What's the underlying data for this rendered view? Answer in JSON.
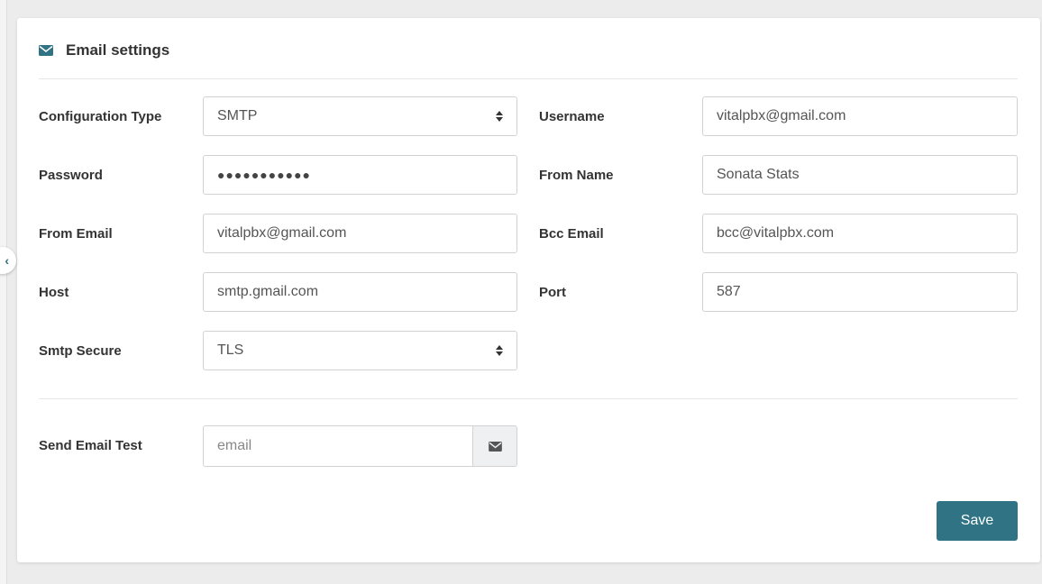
{
  "card": {
    "title": "Email settings",
    "icon": "envelope-icon"
  },
  "colors": {
    "accent": "#2f7384",
    "background": "#ececec"
  },
  "fields": {
    "configuration_type": {
      "label": "Configuration Type",
      "value": "SMTP"
    },
    "username": {
      "label": "Username",
      "value": "vitalpbx@gmail.com"
    },
    "password": {
      "label": "Password",
      "value": "●●●●●●●●●●●"
    },
    "from_name": {
      "label": "From Name",
      "value": "Sonata Stats"
    },
    "from_email": {
      "label": "From Email",
      "value": "vitalpbx@gmail.com"
    },
    "bcc_email": {
      "label": "Bcc Email",
      "value": "bcc@vitalpbx.com"
    },
    "host": {
      "label": "Host",
      "value": "smtp.gmail.com"
    },
    "port": {
      "label": "Port",
      "value": "587"
    },
    "smtp_secure": {
      "label": "Smtp Secure",
      "value": "TLS"
    }
  },
  "send_test": {
    "label": "Send Email Test",
    "placeholder": "email",
    "icon": "envelope-icon"
  },
  "actions": {
    "save_label": "Save"
  },
  "sidebar_toggle": {
    "icon": "chevron-left-icon",
    "glyph": "‹"
  }
}
